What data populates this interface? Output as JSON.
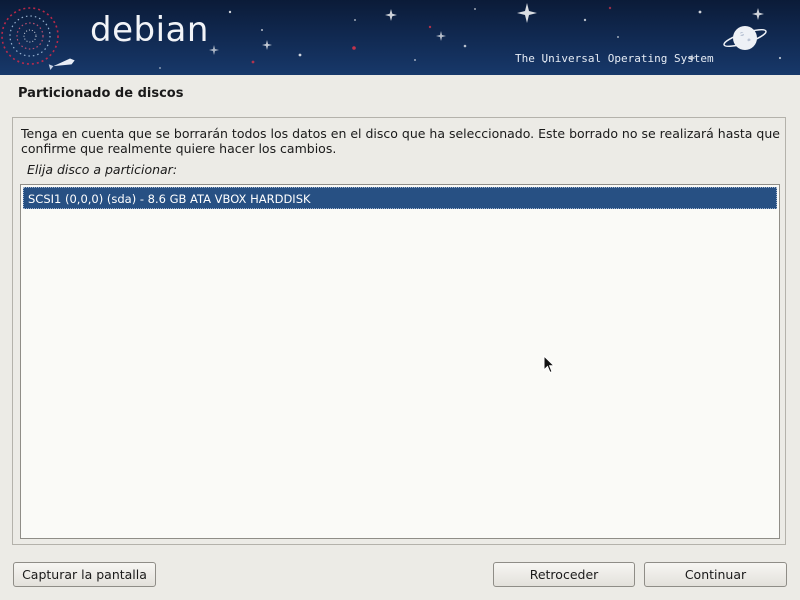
{
  "banner": {
    "brand": "debian",
    "tagline": "The Universal Operating System",
    "colors": {
      "background": "#10284f",
      "text": "#f2f4f8"
    }
  },
  "page": {
    "title": "Particionado de discos"
  },
  "content": {
    "notice": "Tenga en cuenta que se borrarán todos los datos en el disco que ha seleccionado. Este borrado no se realizará hasta que confirme que realmente quiere hacer los cambios.",
    "prompt": "Elija disco a particionar:",
    "disks": [
      {
        "label": "SCSI1 (0,0,0) (sda) - 8.6 GB ATA VBOX HARDDISK",
        "selected": true
      }
    ],
    "selection_color": "#275083"
  },
  "buttons": {
    "screenshot": "Capturar la pantalla",
    "back": "Retroceder",
    "continue": "Continuar"
  },
  "icons": {
    "swirl": "debian-swirl-icon",
    "planet": "ringed-planet-icon",
    "rocket": "rocket-icon",
    "cursor": "mouse-pointer-icon"
  }
}
